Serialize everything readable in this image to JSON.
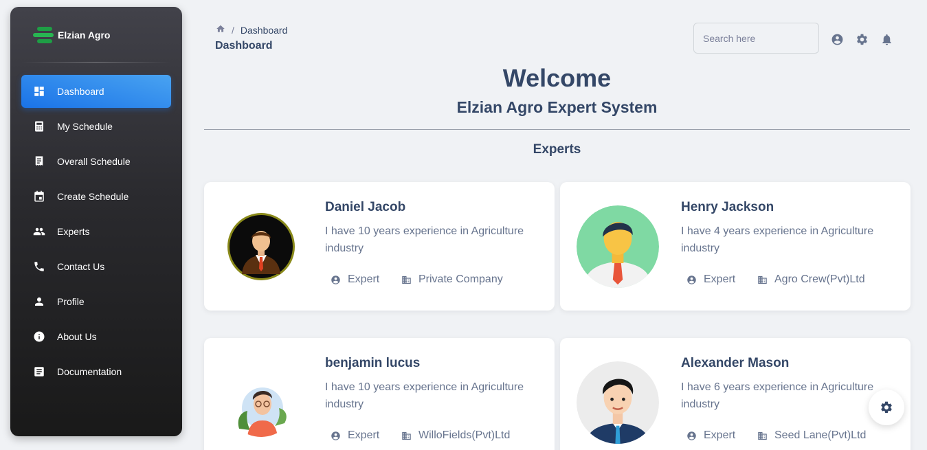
{
  "brand": {
    "name": "Elzian Agro",
    "logo_color": "#1e9e45"
  },
  "sidebar": {
    "items": [
      {
        "label": "Dashboard",
        "icon": "dashboard-icon",
        "active": true
      },
      {
        "label": "My Schedule",
        "icon": "calculator-icon"
      },
      {
        "label": "Overall Schedule",
        "icon": "receipt-icon"
      },
      {
        "label": "Create Schedule",
        "icon": "calendar-icon"
      },
      {
        "label": "Experts",
        "icon": "people-icon"
      },
      {
        "label": "Contact Us",
        "icon": "phone-icon"
      },
      {
        "label": "Profile",
        "icon": "person-icon"
      },
      {
        "label": "About Us",
        "icon": "info-icon"
      },
      {
        "label": "Documentation",
        "icon": "document-icon"
      }
    ]
  },
  "header": {
    "breadcrumb_current": "Dashboard",
    "breadcrumb_separator": "/",
    "page_title": "Dashboard",
    "search_placeholder": "Search here"
  },
  "main": {
    "welcome": "Welcome",
    "subtitle": "Elzian Agro Expert System",
    "section_title": "Experts",
    "experts": [
      {
        "name": "Daniel Jacob",
        "description": "I have 10 years experience in Agriculture industry",
        "role": "Expert",
        "company": "Private Company"
      },
      {
        "name": "Henry Jackson",
        "description": "I have 4 years experience in Agriculture industry",
        "role": "Expert",
        "company": "Agro Crew(Pvt)Ltd"
      },
      {
        "name": "benjamin lucus",
        "description": "I have 10 years experience in Agriculture industry",
        "role": "Expert",
        "company": "WilloFields(Pvt)Ltd"
      },
      {
        "name": "Alexander Mason",
        "description": "I have 6 years experience in Agriculture industry",
        "role": "Expert",
        "company": "Seed Lane(Pvt)Ltd"
      }
    ]
  },
  "colors": {
    "accent": "#1a73e8",
    "text": "#344767",
    "muted": "#67748e"
  }
}
